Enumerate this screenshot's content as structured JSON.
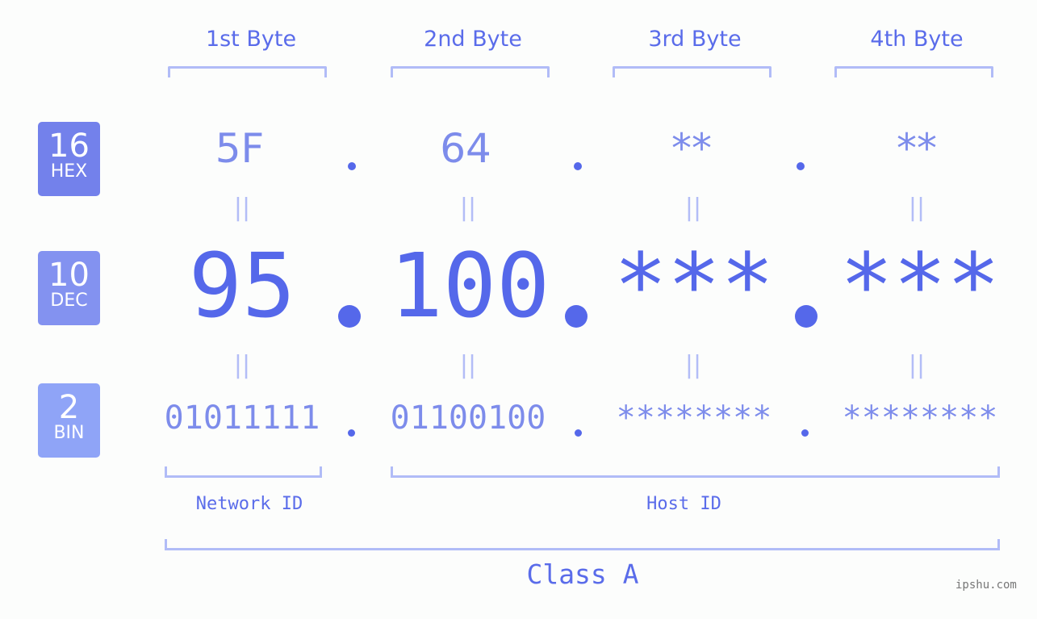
{
  "bytes": [
    {
      "label": "1st Byte",
      "hex": "5F",
      "dec": "95",
      "bin": "01011111"
    },
    {
      "label": "2nd Byte",
      "hex": "64",
      "dec": "100",
      "bin": "01100100"
    },
    {
      "label": "3rd Byte",
      "hex": "**",
      "dec": "***",
      "bin": "********"
    },
    {
      "label": "4th Byte",
      "hex": "**",
      "dec": "***",
      "bin": "********"
    }
  ],
  "badges": {
    "hex": {
      "num": "16",
      "base": "HEX",
      "color": "#7381eb"
    },
    "dec": {
      "num": "10",
      "base": "DEC",
      "color": "#8392f0"
    },
    "bin": {
      "num": "2",
      "base": "BIN",
      "color": "#8fa4f7"
    }
  },
  "equals_glyph": "||",
  "network_label": "Network ID",
  "host_label": "Host ID",
  "class_label": "Class A",
  "brand": "ipshu.com"
}
